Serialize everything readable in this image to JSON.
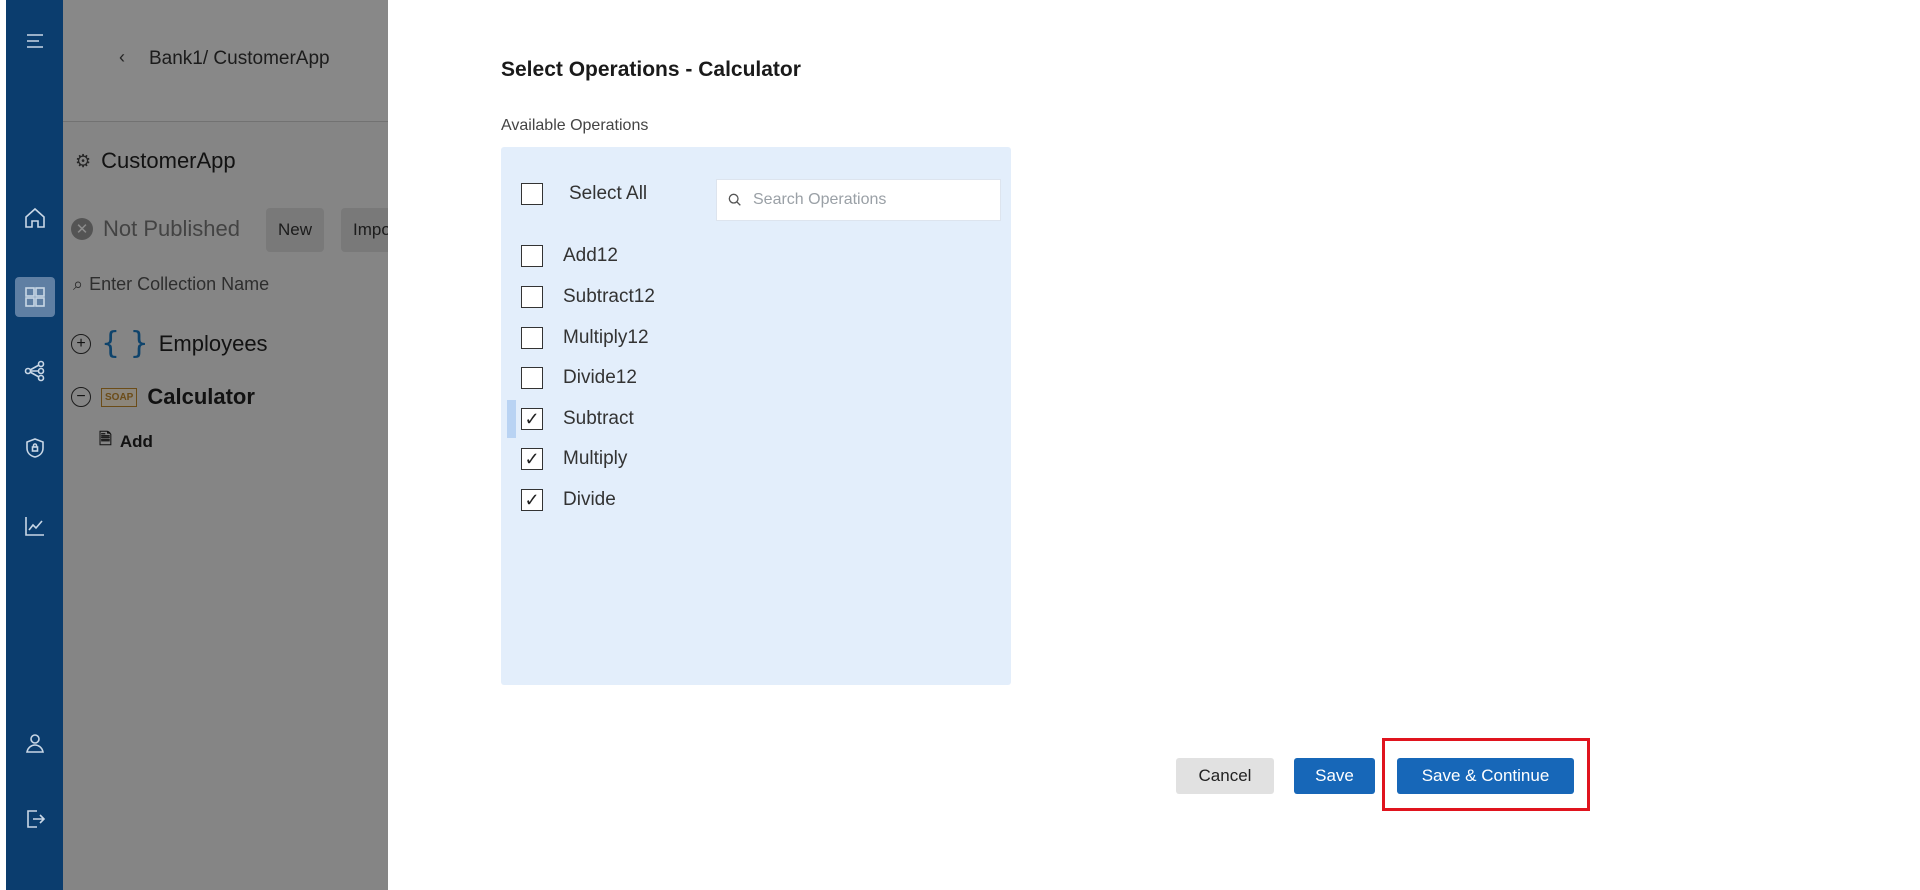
{
  "nav": {
    "items": [
      {
        "icon": "menu-icon"
      },
      {
        "icon": "home-icon"
      },
      {
        "icon": "dashboard-icon",
        "active": true
      },
      {
        "icon": "share-icon"
      },
      {
        "icon": "shield-icon"
      },
      {
        "icon": "analytics-icon"
      },
      {
        "icon": "user-icon"
      },
      {
        "icon": "logout-icon"
      }
    ]
  },
  "background": {
    "breadcrumb": "Bank1/ CustomerApp",
    "app_title": "CustomerApp",
    "status": "Not Published",
    "new_label": "New",
    "import_label": "Impo",
    "search_placeholder": "Enter Collection Name",
    "collections": [
      {
        "name": "Employees",
        "type_icon": "{ }"
      },
      {
        "name": "Calculator",
        "type_icon": "SOAP"
      }
    ],
    "operation": "Add"
  },
  "modal": {
    "title": "Select Operations - Calculator",
    "section_label": "Available Operations",
    "select_all_label": "Select All",
    "search_placeholder": "Search Operations",
    "operations": [
      {
        "label": "Add12",
        "checked": false
      },
      {
        "label": "Subtract12",
        "checked": false
      },
      {
        "label": "Multiply12",
        "checked": false
      },
      {
        "label": "Divide12",
        "checked": false
      },
      {
        "label": "Subtract",
        "checked": true
      },
      {
        "label": "Multiply",
        "checked": true
      },
      {
        "label": "Divide",
        "checked": true
      }
    ],
    "cancel_label": "Cancel",
    "save_label": "Save",
    "save_continue_label": "Save & Continue"
  },
  "colors": {
    "rail": "#0b3d6e",
    "primary": "#1767b8",
    "panel": "#e3eefb",
    "highlight": "#e0141e"
  }
}
